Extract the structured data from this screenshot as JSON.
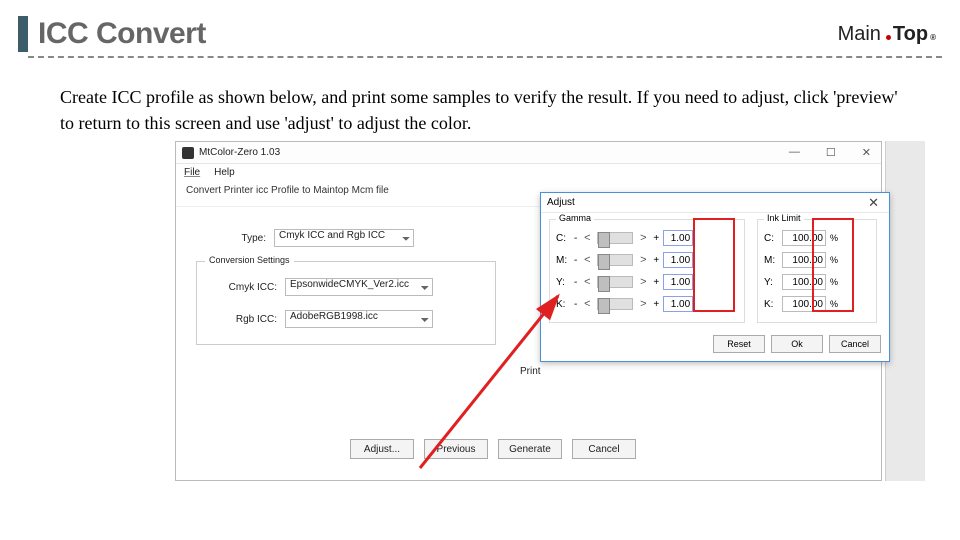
{
  "slide": {
    "title": "ICC Convert",
    "body_text": "Create ICC profile as shown below, and print some samples to verify the result. If you need to adjust, click 'preview' to return to this screen and use 'adjust' to adjust the color.",
    "logo_part1": "Main",
    "logo_part2": "Top"
  },
  "app": {
    "window_title": "MtColor-Zero 1.03",
    "menu": {
      "file": "File",
      "help": "Help"
    },
    "subtitle": "Convert Printer icc Profile to Maintop Mcm file",
    "type_label": "Type:",
    "type_value": "Cmyk ICC and Rgb ICC",
    "group_title": "Conversion Settings",
    "cmyk_label": "Cmyk ICC:",
    "cmyk_value": "EpsonwideCMYK_Ver2.icc",
    "rgb_label": "Rgb ICC:",
    "rgb_value": "AdobeRGB1998.icc",
    "print_label": "Print",
    "buttons": {
      "adjust": "Adjust...",
      "previous": "Previous",
      "generate": "Generate",
      "cancel": "Cancel"
    }
  },
  "dialog": {
    "title": "Adjust",
    "gamma_title": "Gamma",
    "inklimit_title": "Ink Limit",
    "channels": [
      "C:",
      "M:",
      "Y:",
      "K:"
    ],
    "gamma_vals": [
      "1.00",
      "1.00",
      "1.00",
      "1.00"
    ],
    "ink_vals": [
      "100.00",
      "100.00",
      "100.00",
      "100.00"
    ],
    "pct": "%",
    "buttons": {
      "reset": "Reset",
      "ok": "Ok",
      "cancel": "Cancel"
    }
  }
}
